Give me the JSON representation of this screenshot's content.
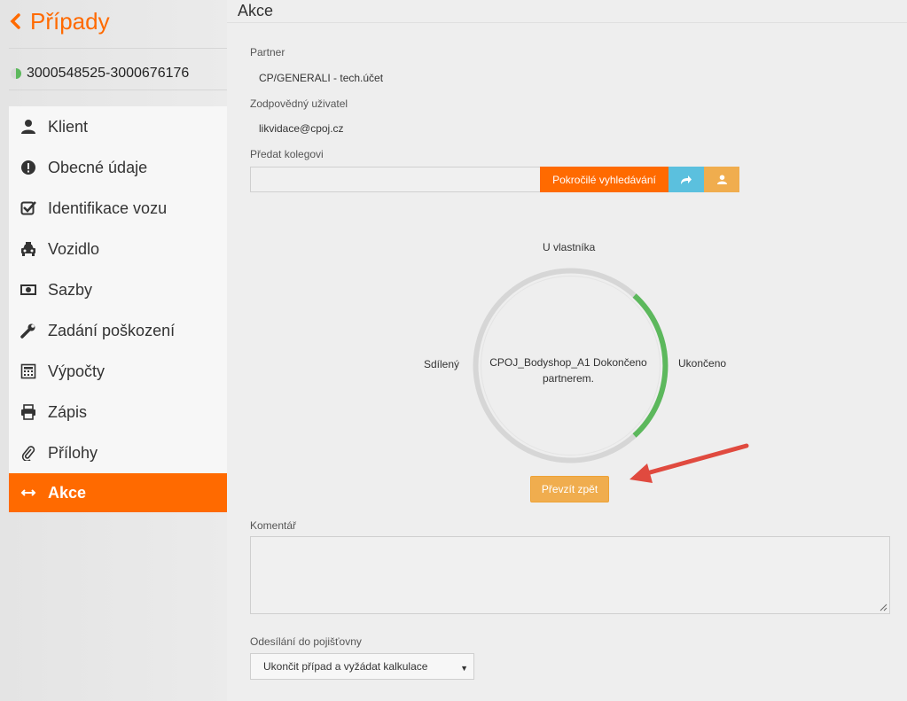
{
  "nav": {
    "back_label": "Případy",
    "case_id": "3000548525-3000676176"
  },
  "menu": {
    "items": [
      {
        "label": "Klient",
        "icon": "user-icon"
      },
      {
        "label": "Obecné údaje",
        "icon": "exclamation-circle-icon"
      },
      {
        "label": "Identifikace vozu",
        "icon": "checkbox-checked-icon"
      },
      {
        "label": "Vozidlo",
        "icon": "car-icon"
      },
      {
        "label": "Sazby",
        "icon": "money-icon"
      },
      {
        "label": "Zadání poškození",
        "icon": "wrench-icon"
      },
      {
        "label": "Výpočty",
        "icon": "calculator-icon"
      },
      {
        "label": "Zápis",
        "icon": "print-icon"
      },
      {
        "label": "Přílohy",
        "icon": "paperclip-icon"
      },
      {
        "label": "Akce",
        "icon": "arrows-horizontal-icon",
        "active": true
      }
    ]
  },
  "main": {
    "title": "Akce",
    "partner_label": "Partner",
    "partner_value": "CP/GENERALI - tech.účet",
    "responsible_label": "Zodpovědný uživatel",
    "responsible_value": "likvidace@cpoj.cz",
    "colleague_label": "Předat kolegovi",
    "colleague_value": "",
    "advanced_search_label": "Pokročilé vyhledávání",
    "status": {
      "top_label": "U vlastníka",
      "right_label": "Ukončeno",
      "left_label": "Sdílený",
      "center_text": "CPOJ_Bodyshop_A1 Dokončeno partnerem."
    },
    "take_back_label": "Převzít zpět",
    "comment_label": "Komentář",
    "comment_value": "",
    "send_label": "Odesílání do pojišťovny",
    "send_selected": "Ukončit případ a vyžádat kalkulace"
  },
  "colors": {
    "accent": "#ff6a00",
    "info": "#5bc0de",
    "warning": "#f0ad4e",
    "progress": "#5cb85c",
    "annotation_arrow": "#e04a3f"
  }
}
